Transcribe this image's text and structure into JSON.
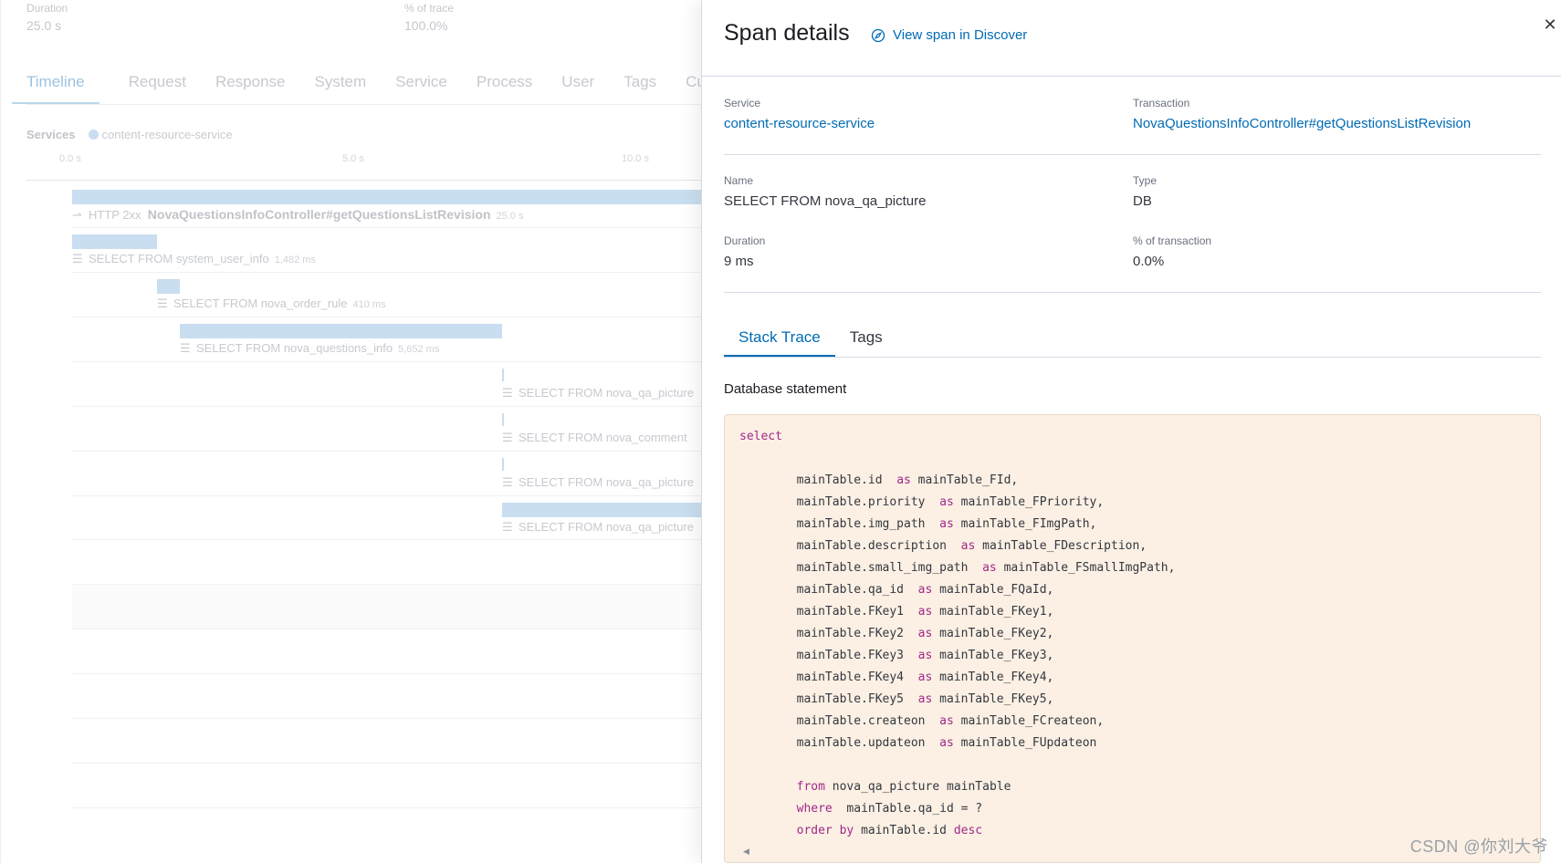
{
  "trace": {
    "duration_label": "Duration",
    "duration_value": "25.0 s",
    "pct_label": "% of trace",
    "pct_value": "100.0%",
    "tabs": [
      "Timeline",
      "Request",
      "Response",
      "System",
      "Service",
      "Process",
      "User",
      "Tags",
      "Cust"
    ],
    "services_label": "Services",
    "service_name": "content-resource-service",
    "axis_ticks": [
      "0.0 s",
      "5.0 s",
      "10.0 s"
    ],
    "spans": [
      {
        "type": "HTTP 2xx",
        "name": "NovaQuestionsInfoController#getQuestionsListRevision",
        "duration": "25.0 s"
      },
      {
        "name": "SELECT FROM system_user_info",
        "duration": "1,482 ms"
      },
      {
        "name": "SELECT FROM nova_order_rule",
        "duration": "410 ms"
      },
      {
        "name": "SELECT FROM nova_questions_info",
        "duration": "5,652 ms"
      },
      {
        "name": "SELECT FROM nova_qa_picture",
        "duration": ""
      },
      {
        "name": "SELECT FROM nova_comment",
        "duration": ""
      },
      {
        "name": "SELECT FROM nova_qa_picture",
        "duration": ""
      },
      {
        "name": "SELECT FROM nova_qa_picture",
        "duration": ""
      }
    ]
  },
  "flyout": {
    "title": "Span details",
    "discover_link": "View span in Discover",
    "discover_icon": "compass-icon",
    "close_icon": "close-icon",
    "service_label": "Service",
    "service_value": "content-resource-service",
    "transaction_label": "Transaction",
    "transaction_value": "NovaQuestionsInfoController#getQuestionsListRevision",
    "name_label": "Name",
    "name_value": "SELECT FROM nova_qa_picture",
    "type_label": "Type",
    "type_value": "DB",
    "duration_label": "Duration",
    "duration_value": "9 ms",
    "pct_label": "% of transaction",
    "pct_value": "0.0%",
    "tabs": [
      "Stack Trace",
      "Tags"
    ],
    "db_statement_title": "Database statement",
    "sql": {
      "select": "select",
      "columns": [
        {
          "expr": "mainTable.id",
          "alias": "mainTable_FId,"
        },
        {
          "expr": "mainTable.priority",
          "alias": "mainTable_FPriority,"
        },
        {
          "expr": "mainTable.img_path",
          "alias": "mainTable_FImgPath,"
        },
        {
          "expr": "mainTable.description",
          "alias": "mainTable_FDescription,"
        },
        {
          "expr": "mainTable.small_img_path",
          "alias": "mainTable_FSmallImgPath,"
        },
        {
          "expr": "mainTable.qa_id",
          "alias": "mainTable_FQaId,"
        },
        {
          "expr": "mainTable.FKey1",
          "alias": "mainTable_FKey1,"
        },
        {
          "expr": "mainTable.FKey2",
          "alias": "mainTable_FKey2,"
        },
        {
          "expr": "mainTable.FKey3",
          "alias": "mainTable_FKey3,"
        },
        {
          "expr": "mainTable.FKey4",
          "alias": "mainTable_FKey4,"
        },
        {
          "expr": "mainTable.FKey5",
          "alias": "mainTable_FKey5,"
        },
        {
          "expr": "mainTable.createon",
          "alias": "mainTable_FCreateon,"
        },
        {
          "expr": "mainTable.updateon",
          "alias": "mainTable_FUpdateon"
        }
      ],
      "as_kw": "as",
      "from_kw": "from",
      "from_rest": "nova_qa_picture mainTable",
      "where_kw": "where",
      "where_rest": "mainTable.qa_id = ?",
      "order_kw": "order by",
      "order_mid": "mainTable.id",
      "desc_kw": "desc"
    }
  },
  "watermark": "CSDN @你刘大爷"
}
